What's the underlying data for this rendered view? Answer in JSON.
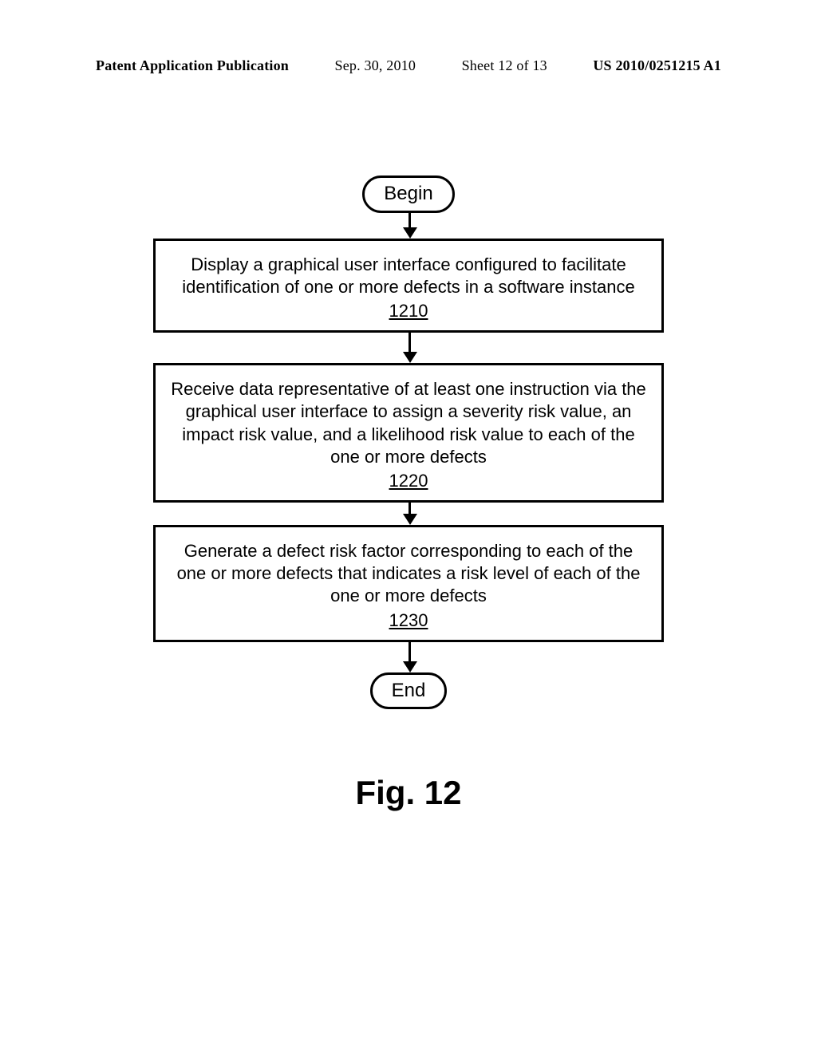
{
  "header": {
    "doc_type": "Patent Application Publication",
    "date": "Sep. 30, 2010",
    "sheet": "Sheet 12 of 13",
    "pub_number": "US 2010/0251215 A1"
  },
  "flowchart": {
    "begin": "Begin",
    "end": "End",
    "steps": [
      {
        "text": "Display a graphical user interface configured to facilitate identification of one or more defects in a software instance",
        "ref": "1210"
      },
      {
        "text": "Receive data representative of at least one instruction via the graphical user interface to assign a severity risk value, an impact risk value, and a likelihood risk value to each of the one or more defects",
        "ref": "1220"
      },
      {
        "text": "Generate a defect risk factor corresponding to each of the one or more defects that indicates a risk level of each of the one or more defects",
        "ref": "1230"
      }
    ]
  },
  "figure_label": "Fig. 12"
}
